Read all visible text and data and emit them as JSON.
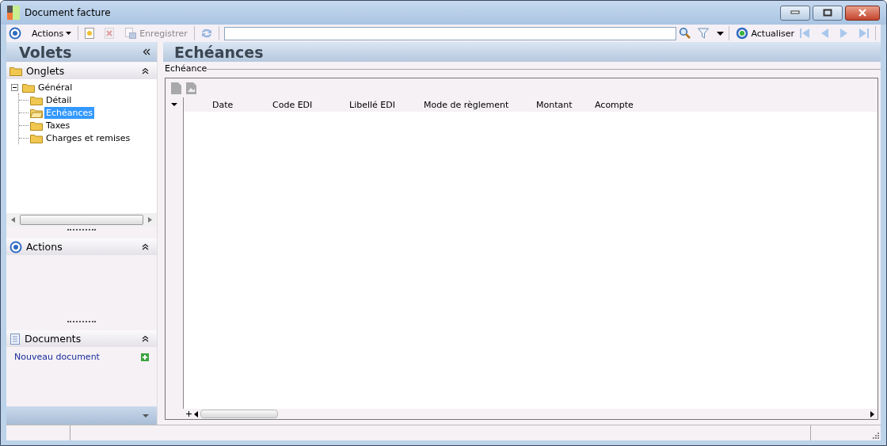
{
  "window": {
    "title": "Document facture"
  },
  "toolbar": {
    "actions_label": "Actions",
    "save": {
      "label": "Enregistrer",
      "disabled": true
    },
    "refresh_label": "Actualiser"
  },
  "sidebar": {
    "title": "Volets",
    "sections": [
      {
        "kind": "tree",
        "title": "Onglets",
        "expanded": true,
        "tree": [
          {
            "label": "Général",
            "expanded": true,
            "selected": false,
            "children": [
              {
                "label": "Détail",
                "selected": false
              },
              {
                "label": "Echéances",
                "selected": true
              },
              {
                "label": "Taxes",
                "selected": false
              },
              {
                "label": "Charges et remises",
                "selected": false
              }
            ]
          }
        ]
      },
      {
        "kind": "actions",
        "title": "Actions",
        "expanded": true
      },
      {
        "kind": "documents",
        "title": "Documents",
        "expanded": true,
        "links": [
          "Nouveau document"
        ]
      }
    ]
  },
  "main": {
    "title": "Echéances",
    "group": "Echéance",
    "table": {
      "columns": [
        "Date",
        "Code EDI",
        "Libellé EDI",
        "Mode de règlement",
        "Montant",
        "Acompte"
      ]
    }
  }
}
